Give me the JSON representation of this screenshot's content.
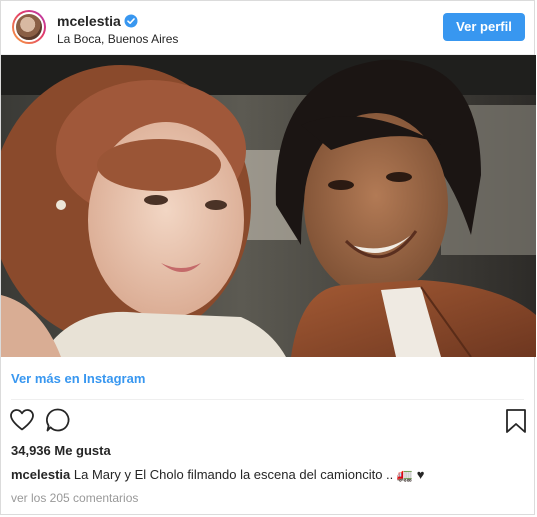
{
  "header": {
    "username": "mcelestia",
    "location": "La Boca, Buenos Aires",
    "follow_button": "Ver perfil"
  },
  "post": {
    "view_more": "Ver más en Instagram",
    "likes": "34,936 Me gusta",
    "caption_user": "mcelestia",
    "caption_text": "La Mary y El Cholo filmando la escena del camioncito ..",
    "caption_emoji": "🚛 ♥",
    "comments_link": "ver los 205 comentarios"
  },
  "icons": {
    "verified": "verified-badge-icon",
    "like": "heart-icon",
    "comment": "comment-bubble-icon",
    "save": "bookmark-icon"
  },
  "colors": {
    "accent": "#3897f0",
    "text": "#262626",
    "muted": "#999999"
  }
}
